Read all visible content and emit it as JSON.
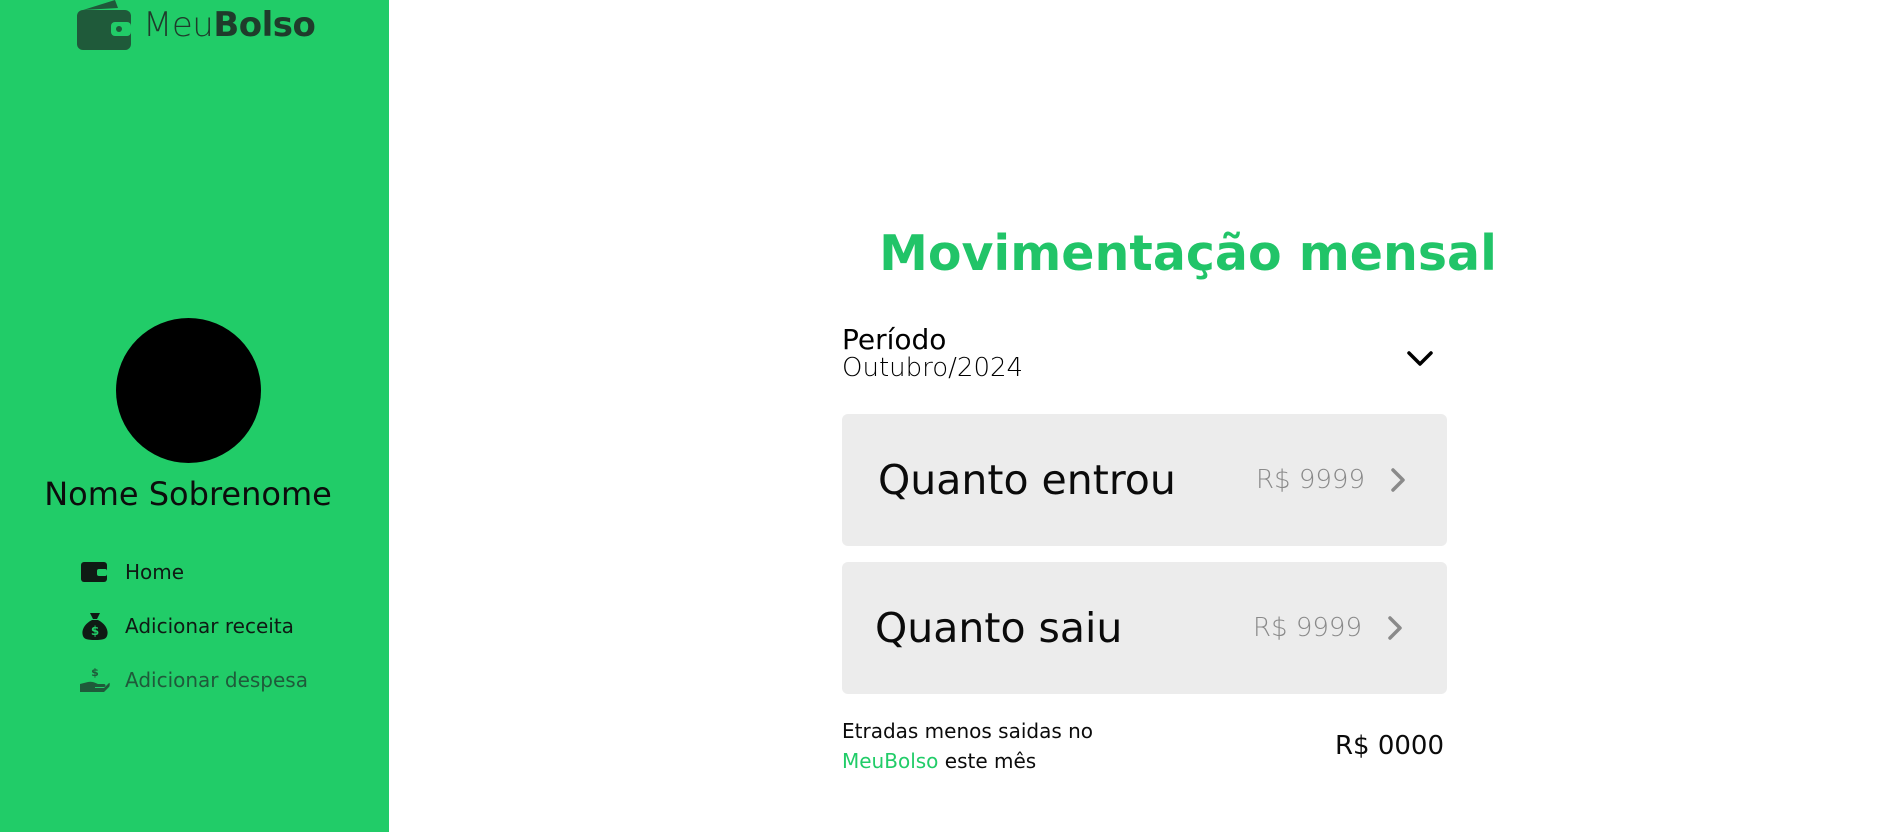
{
  "brand": {
    "name_light": "Meu",
    "name_bold": "Bolso",
    "icon": "wallet-icon"
  },
  "user": {
    "name": "Nome Sobrenome"
  },
  "nav": {
    "items": [
      {
        "label": "Home",
        "icon": "wallet-icon"
      },
      {
        "label": "Adicionar receita",
        "icon": "money-bag-icon"
      },
      {
        "label": "Adicionar despesa",
        "icon": "hand-coin-icon"
      }
    ]
  },
  "main": {
    "title": "Movimentação mensal",
    "period": {
      "label": "Período",
      "value": "Outubro/2024"
    },
    "cards": {
      "income": {
        "title": "Quanto entrou",
        "amount": "R$ 9999"
      },
      "expense": {
        "title": "Quanto saiu",
        "amount": "R$ 9999"
      }
    },
    "summary": {
      "line1": "Etradas menos saidas no",
      "brand": "MeuBolso",
      "line2_suffix": " este mês",
      "total": "R$ 0000"
    }
  },
  "colors": {
    "accent": "#21cc68",
    "card_bg": "#ececec",
    "muted_text": "#8a8a8a"
  }
}
